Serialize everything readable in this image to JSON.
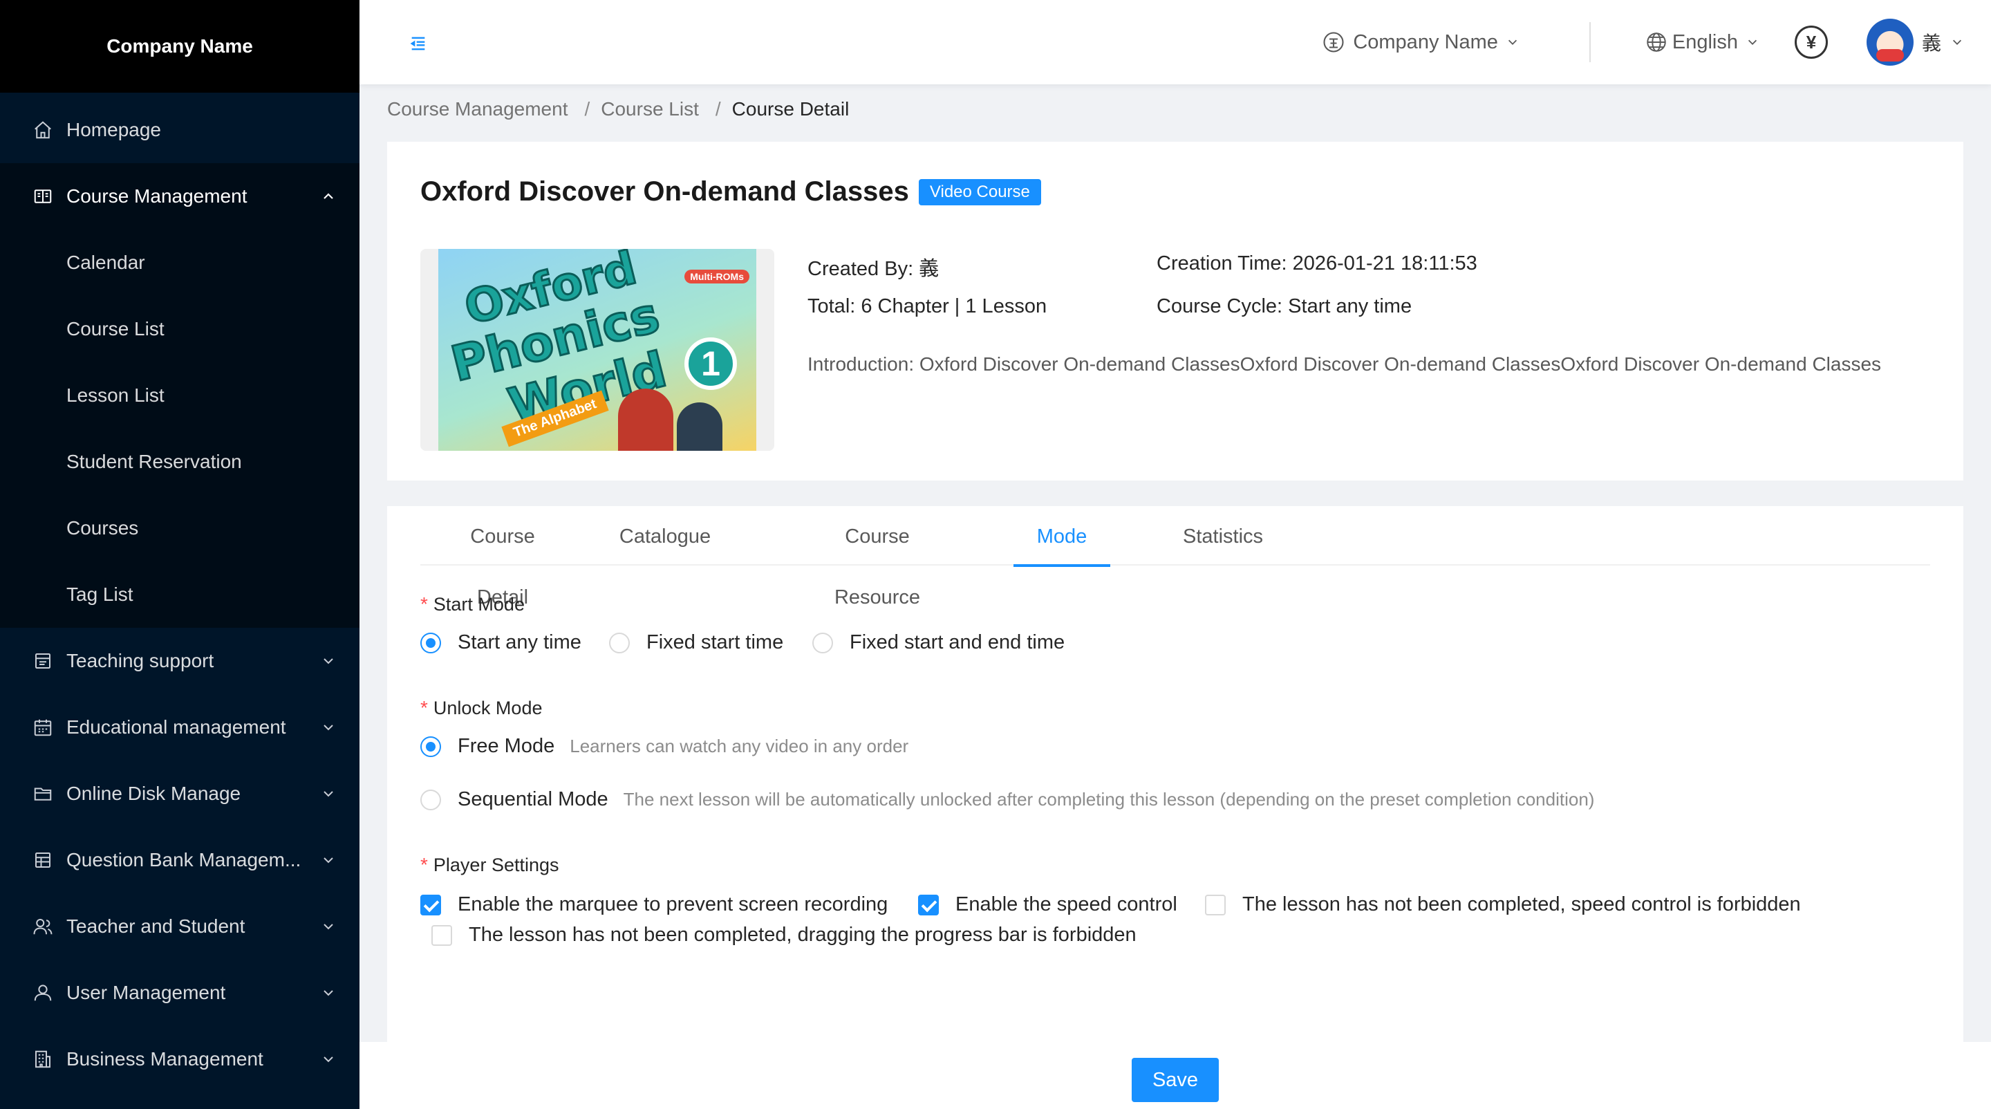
{
  "sidebar": {
    "company_name": "Company Name",
    "items": [
      {
        "label": "Homepage",
        "icon": "home-icon"
      },
      {
        "label": "Course Management",
        "icon": "book-icon",
        "open": true,
        "children": [
          "Calendar",
          "Course List",
          "Lesson List",
          "Student Reservation",
          "Courses",
          "Tag List"
        ]
      },
      {
        "label": "Teaching support",
        "icon": "support-icon"
      },
      {
        "label": "Educational management",
        "icon": "calendar-icon"
      },
      {
        "label": "Online Disk Manage",
        "icon": "folder-icon"
      },
      {
        "label": "Question Bank Managem...",
        "icon": "table-icon"
      },
      {
        "label": "Teacher and Student",
        "icon": "users-icon"
      },
      {
        "label": "User Management",
        "icon": "user-icon"
      },
      {
        "label": "Business Management",
        "icon": "building-icon"
      }
    ]
  },
  "header": {
    "company_switch": "Company Name",
    "language": "English",
    "currency_symbol": "¥",
    "user_name": "義"
  },
  "breadcrumb": [
    "Course Management",
    "Course List",
    "Course Detail"
  ],
  "course": {
    "title": "Oxford Discover On-demand Classes",
    "type_tag": "Video Course",
    "cover_text": {
      "line1": "Oxford",
      "line2": "Phonics",
      "line3": "World",
      "number": "1",
      "badge": "Multi-ROMs",
      "subtitle": "The Alphabet"
    },
    "created_by": "Created By: 義",
    "creation_time": "Creation Time: 2026-01-21 18:11:53",
    "total": "Total: 6 Chapter | 1 Lesson",
    "course_cycle": "Course Cycle: Start any time",
    "introduction": "Introduction: Oxford Discover On-demand ClassesOxford Discover On-demand ClassesOxford Discover On-demand Classes"
  },
  "tabs": [
    "Course Detail",
    "Catalogue",
    "Course Resource",
    "Mode",
    "Statistics"
  ],
  "active_tab": "Mode",
  "mode_form": {
    "start_mode": {
      "label": "Start Mode",
      "options": [
        "Start any time",
        "Fixed start time",
        "Fixed start and end time"
      ],
      "selected": "Start any time"
    },
    "unlock_mode": {
      "label": "Unlock Mode",
      "options": [
        {
          "label": "Free Mode",
          "hint": "Learners can watch any video in any order"
        },
        {
          "label": "Sequential Mode",
          "hint": "The next lesson will be automatically unlocked after completing this lesson (depending on the preset completion condition)"
        }
      ],
      "selected": "Free Mode"
    },
    "player_settings": {
      "label": "Player Settings",
      "options": [
        {
          "label": "Enable the marquee to prevent screen recording",
          "checked": true
        },
        {
          "label": "Enable the speed control",
          "checked": true
        },
        {
          "label": "The lesson has not been completed, speed control is forbidden",
          "checked": false
        },
        {
          "label": "The lesson has not been completed, dragging the progress bar is forbidden",
          "checked": false
        }
      ]
    }
  },
  "save_label": "Save",
  "colors": {
    "primary": "#1890ff",
    "sidebar_bg": "#001529",
    "required": "#ff4d4f"
  }
}
